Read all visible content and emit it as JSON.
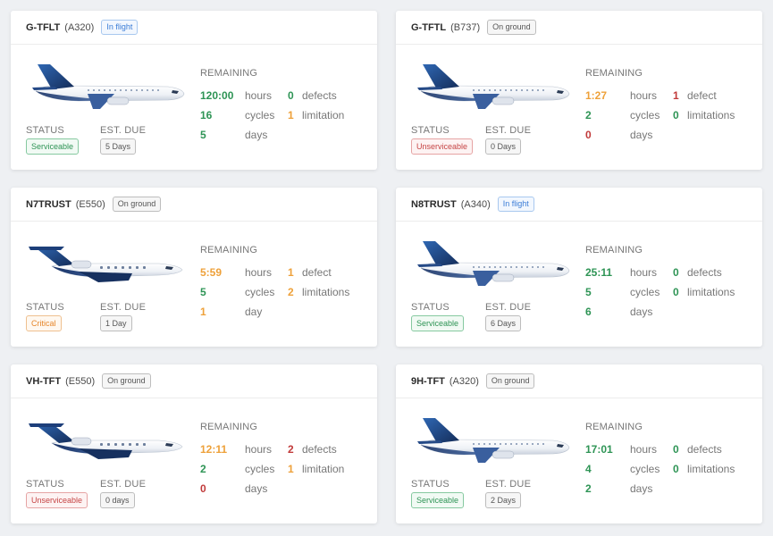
{
  "cards": [
    {
      "registration": "G-TFLT",
      "model": "(A320)",
      "location": "In flight",
      "location_type": "flight",
      "plane_icon": "airliner-icon",
      "remaining_label": "REMAINING",
      "hours": {
        "value": "120:00",
        "unit": "hours",
        "color": "green"
      },
      "cycles": {
        "value": "16",
        "unit": "cycles",
        "color": "green"
      },
      "days": {
        "value": "5",
        "unit": "days",
        "color": "green"
      },
      "defects": {
        "value": "0",
        "unit": "defects",
        "color": "green"
      },
      "limitations": {
        "value": "1",
        "unit": "limitation",
        "color": "orange"
      },
      "status_label": "STATUS",
      "status": "Serviceable",
      "status_type": "serviceable",
      "due_label": "EST. DUE",
      "due": "5 Days"
    },
    {
      "registration": "G-TFTL",
      "model": "(B737)",
      "location": "On ground",
      "location_type": "ground",
      "plane_icon": "airliner-icon",
      "remaining_label": "REMAINING",
      "hours": {
        "value": "1:27",
        "unit": "hours",
        "color": "orange"
      },
      "cycles": {
        "value": "2",
        "unit": "cycles",
        "color": "green"
      },
      "days": {
        "value": "0",
        "unit": "days",
        "color": "red"
      },
      "defects": {
        "value": "1",
        "unit": "defect",
        "color": "red"
      },
      "limitations": {
        "value": "0",
        "unit": "limitations",
        "color": "green"
      },
      "status_label": "STATUS",
      "status": "Unserviceable",
      "status_type": "unserviceable",
      "due_label": "EST. DUE",
      "due": "0 Days"
    },
    {
      "registration": "N7TRUST",
      "model": "(E550)",
      "location": "On ground",
      "location_type": "ground",
      "plane_icon": "business-jet-icon",
      "remaining_label": "REMAINING",
      "hours": {
        "value": "5:59",
        "unit": "hours",
        "color": "orange"
      },
      "cycles": {
        "value": "5",
        "unit": "cycles",
        "color": "green"
      },
      "days": {
        "value": "1",
        "unit": "day",
        "color": "orange"
      },
      "defects": {
        "value": "1",
        "unit": "defect",
        "color": "orange"
      },
      "limitations": {
        "value": "2",
        "unit": "limitations",
        "color": "orange"
      },
      "status_label": "STATUS",
      "status": "Critical",
      "status_type": "critical",
      "due_label": "EST. DUE",
      "due": "1 Day"
    },
    {
      "registration": "N8TRUST",
      "model": "(A340)",
      "location": "In flight",
      "location_type": "flight",
      "plane_icon": "airliner-icon",
      "remaining_label": "REMAINING",
      "hours": {
        "value": "25:11",
        "unit": "hours",
        "color": "green"
      },
      "cycles": {
        "value": "5",
        "unit": "cycles",
        "color": "green"
      },
      "days": {
        "value": "6",
        "unit": "days",
        "color": "green"
      },
      "defects": {
        "value": "0",
        "unit": "defects",
        "color": "green"
      },
      "limitations": {
        "value": "0",
        "unit": "limitations",
        "color": "green"
      },
      "status_label": "STATUS",
      "status": "Serviceable",
      "status_type": "serviceable",
      "due_label": "EST. DUE",
      "due": "6 Days"
    },
    {
      "registration": "VH-TFT",
      "model": "(E550)",
      "location": "On ground",
      "location_type": "ground",
      "plane_icon": "business-jet-icon",
      "remaining_label": "REMAINING",
      "hours": {
        "value": "12:11",
        "unit": "hours",
        "color": "orange"
      },
      "cycles": {
        "value": "2",
        "unit": "cycles",
        "color": "green"
      },
      "days": {
        "value": "0",
        "unit": "days",
        "color": "red"
      },
      "defects": {
        "value": "2",
        "unit": "defects",
        "color": "red"
      },
      "limitations": {
        "value": "1",
        "unit": "limitation",
        "color": "orange"
      },
      "status_label": "STATUS",
      "status": "Unserviceable",
      "status_type": "unserviceable",
      "due_label": "EST. DUE",
      "due": "0 days"
    },
    {
      "registration": "9H-TFT",
      "model": "(A320)",
      "location": "On ground",
      "location_type": "ground",
      "plane_icon": "airliner-icon",
      "remaining_label": "REMAINING",
      "hours": {
        "value": "17:01",
        "unit": "hours",
        "color": "green"
      },
      "cycles": {
        "value": "4",
        "unit": "cycles",
        "color": "green"
      },
      "days": {
        "value": "2",
        "unit": "days",
        "color": "green"
      },
      "defects": {
        "value": "0",
        "unit": "defects",
        "color": "green"
      },
      "limitations": {
        "value": "0",
        "unit": "limitations",
        "color": "green"
      },
      "status_label": "STATUS",
      "status": "Serviceable",
      "status_type": "serviceable",
      "due_label": "EST. DUE",
      "due": "2 Days"
    }
  ],
  "colors": {
    "green": "#2e9455",
    "orange": "#eea13a",
    "red": "#c13a3a",
    "fuselage": "#f2f4f8",
    "tail": "#1d3f7a"
  }
}
